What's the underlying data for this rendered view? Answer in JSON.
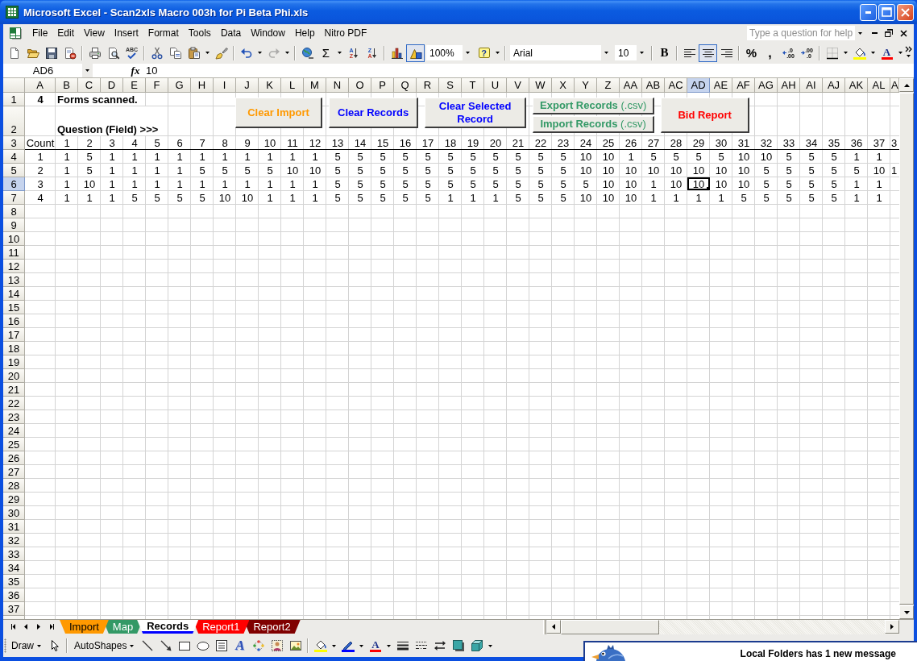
{
  "window": {
    "title": "Microsoft Excel - Scan2xls Macro 003h for Pi Beta Phi.xls"
  },
  "menu_bar": {
    "items": [
      "File",
      "Edit",
      "View",
      "Insert",
      "Format",
      "Tools",
      "Data",
      "Window",
      "Help",
      "Nitro PDF"
    ],
    "help_box": {
      "placeholder": "Type a question for help"
    }
  },
  "standard_toolbar": {
    "groups": [
      [
        {
          "kind": "new",
          "pressed": false,
          "disabled": false
        },
        {
          "kind": "open",
          "pressed": false,
          "disabled": false
        },
        {
          "kind": "save",
          "pressed": false,
          "disabled": false
        },
        {
          "kind": "permission",
          "pressed": false,
          "disabled": false
        }
      ],
      [
        {
          "kind": "print",
          "pressed": false,
          "disabled": false
        },
        {
          "kind": "print-preview",
          "pressed": false,
          "disabled": false
        },
        {
          "kind": "spelling",
          "label": "ABC",
          "pressed": false,
          "disabled": false
        }
      ],
      [
        {
          "kind": "cut",
          "pressed": false,
          "disabled": false
        },
        {
          "kind": "copy",
          "pressed": false,
          "disabled": false
        },
        {
          "kind": "paste",
          "pressed": false,
          "disabled": false
        },
        {
          "kind": "format-painter",
          "pressed": false,
          "disabled": false
        }
      ],
      [
        {
          "kind": "undo",
          "pressed": false,
          "disabled": false
        },
        {
          "kind": "redo",
          "pressed": false,
          "disabled": true
        }
      ],
      [
        {
          "kind": "hyperlink",
          "pressed": false,
          "disabled": false
        },
        {
          "kind": "autosum",
          "label": "Σ",
          "pressed": false,
          "disabled": false
        },
        {
          "kind": "sort-ascending",
          "glyphs": [
            "A",
            "Z"
          ],
          "pressed": false,
          "disabled": false
        },
        {
          "kind": "sort-descending",
          "glyphs": [
            "Z",
            "A"
          ],
          "pressed": false,
          "disabled": false
        }
      ],
      [
        {
          "kind": "chart-wizard",
          "pressed": false,
          "disabled": false
        },
        {
          "kind": "drawing",
          "pressed": true,
          "disabled": false
        },
        {
          "kind": "zoom",
          "value": "100%"
        },
        {
          "kind": "help",
          "label": "?",
          "pressed": false,
          "disabled": false
        }
      ],
      [
        {
          "kind": "font",
          "value": "Arial"
        },
        {
          "kind": "font-size",
          "value": "10"
        }
      ],
      [
        {
          "kind": "bold",
          "label": "B",
          "pressed": false,
          "disabled": false
        }
      ],
      [
        {
          "kind": "align-left",
          "pressed": false,
          "disabled": false
        },
        {
          "kind": "align-center",
          "pressed": true,
          "disabled": false
        },
        {
          "kind": "align-right",
          "pressed": false,
          "disabled": false
        }
      ],
      [
        {
          "kind": "percent",
          "label": "%",
          "pressed": false,
          "disabled": false
        },
        {
          "kind": "comma",
          "label": ",",
          "pressed": false,
          "disabled": false
        },
        {
          "kind": "increase-decimal",
          "glyphs": [
            ".0",
            ".00"
          ],
          "pressed": false,
          "disabled": false
        },
        {
          "kind": "decrease-decimal",
          "glyphs": [
            ".00",
            ".0"
          ],
          "pressed": false,
          "disabled": false
        }
      ],
      [
        {
          "kind": "borders",
          "pressed": false,
          "disabled": false
        },
        {
          "kind": "fill-color",
          "pressed": false,
          "disabled": false
        },
        {
          "kind": "font-color",
          "label": "A",
          "pressed": false,
          "disabled": false
        }
      ]
    ]
  },
  "formula_bar": {
    "name_box": "AD6",
    "function_label": "fx",
    "formula": "10"
  },
  "sheet": {
    "columns": [
      {
        "label": "A",
        "selected": false
      },
      {
        "label": "B",
        "selected": false
      },
      {
        "label": "C",
        "selected": false
      },
      {
        "label": "D",
        "selected": false
      },
      {
        "label": "E",
        "selected": false
      },
      {
        "label": "F",
        "selected": false
      },
      {
        "label": "G",
        "selected": false
      },
      {
        "label": "H",
        "selected": false
      },
      {
        "label": "I",
        "selected": false
      },
      {
        "label": "J",
        "selected": false
      },
      {
        "label": "K",
        "selected": false
      },
      {
        "label": "L",
        "selected": false
      },
      {
        "label": "M",
        "selected": false
      },
      {
        "label": "N",
        "selected": false
      },
      {
        "label": "O",
        "selected": false
      },
      {
        "label": "P",
        "selected": false
      },
      {
        "label": "Q",
        "selected": false
      },
      {
        "label": "R",
        "selected": false
      },
      {
        "label": "S",
        "selected": false
      },
      {
        "label": "T",
        "selected": false
      },
      {
        "label": "U",
        "selected": false
      },
      {
        "label": "V",
        "selected": false
      },
      {
        "label": "W",
        "selected": false
      },
      {
        "label": "X",
        "selected": false
      },
      {
        "label": "Y",
        "selected": false
      },
      {
        "label": "Z",
        "selected": false
      },
      {
        "label": "AA",
        "selected": false
      },
      {
        "label": "AB",
        "selected": false
      },
      {
        "label": "AC",
        "selected": false
      },
      {
        "label": "AD",
        "selected": true
      },
      {
        "label": "AE",
        "selected": false
      },
      {
        "label": "AF",
        "selected": false
      },
      {
        "label": "AG",
        "selected": false
      },
      {
        "label": "AH",
        "selected": false
      },
      {
        "label": "AI",
        "selected": false
      },
      {
        "label": "AJ",
        "selected": false
      },
      {
        "label": "AK",
        "selected": false
      },
      {
        "label": "AL",
        "selected": false
      },
      {
        "label": "A",
        "selected": false
      }
    ],
    "rows": [
      {
        "label": "1",
        "selected": false
      },
      {
        "label": "2",
        "selected": false
      },
      {
        "label": "3",
        "selected": false
      },
      {
        "label": "4",
        "selected": false
      },
      {
        "label": "5",
        "selected": false
      },
      {
        "label": "6",
        "selected": true
      },
      {
        "label": "7",
        "selected": false
      },
      {
        "label": "8",
        "selected": false
      },
      {
        "label": "9",
        "selected": false
      },
      {
        "label": "10",
        "selected": false
      },
      {
        "label": "11",
        "selected": false
      },
      {
        "label": "12",
        "selected": false
      },
      {
        "label": "13",
        "selected": false
      },
      {
        "label": "14",
        "selected": false
      },
      {
        "label": "15",
        "selected": false
      },
      {
        "label": "16",
        "selected": false
      },
      {
        "label": "17",
        "selected": false
      },
      {
        "label": "18",
        "selected": false
      },
      {
        "label": "19",
        "selected": false
      },
      {
        "label": "20",
        "selected": false
      },
      {
        "label": "21",
        "selected": false
      },
      {
        "label": "22",
        "selected": false
      },
      {
        "label": "23",
        "selected": false
      },
      {
        "label": "24",
        "selected": false
      },
      {
        "label": "25",
        "selected": false
      },
      {
        "label": "26",
        "selected": false
      },
      {
        "label": "27",
        "selected": false
      },
      {
        "label": "28",
        "selected": false
      },
      {
        "label": "29",
        "selected": false
      },
      {
        "label": "30",
        "selected": false
      },
      {
        "label": "31",
        "selected": false
      },
      {
        "label": "32",
        "selected": false
      },
      {
        "label": "33",
        "selected": false
      },
      {
        "label": "34",
        "selected": false
      },
      {
        "label": "35",
        "selected": false
      },
      {
        "label": "36",
        "selected": false
      },
      {
        "label": "37",
        "selected": false
      }
    ],
    "summary": {
      "count": "4",
      "caption": "Forms scanned.",
      "field_caption": "Question (Field) >>>"
    },
    "table": {
      "header": [
        "Count",
        "1",
        "2",
        "3",
        "4",
        "5",
        "6",
        "7",
        "8",
        "9",
        "10",
        "11",
        "12",
        "13",
        "14",
        "15",
        "16",
        "17",
        "18",
        "19",
        "20",
        "21",
        "22",
        "23",
        "24",
        "25",
        "26",
        "27",
        "28",
        "29",
        "30",
        "31",
        "32",
        "33",
        "34",
        "35",
        "36",
        "37",
        "3"
      ],
      "records": [
        [
          "1",
          "1",
          "5",
          "1",
          "1",
          "1",
          "1",
          "1",
          "1",
          "1",
          "1",
          "1",
          "1",
          "5",
          "5",
          "5",
          "5",
          "5",
          "5",
          "5",
          "5",
          "5",
          "5",
          "5",
          "10",
          "10",
          "1",
          "5",
          "5",
          "5",
          "5",
          "10",
          "10",
          "5",
          "5",
          "5",
          "1",
          "1"
        ],
        [
          "2",
          "1",
          "5",
          "1",
          "1",
          "1",
          "1",
          "5",
          "5",
          "5",
          "5",
          "10",
          "10",
          "5",
          "5",
          "5",
          "5",
          "5",
          "5",
          "5",
          "5",
          "5",
          "5",
          "5",
          "10",
          "10",
          "10",
          "10",
          "10",
          "10",
          "10",
          "10",
          "5",
          "5",
          "5",
          "5",
          "5",
          "10",
          "1"
        ],
        [
          "3",
          "1",
          "10",
          "1",
          "1",
          "1",
          "1",
          "1",
          "1",
          "1",
          "1",
          "1",
          "1",
          "5",
          "5",
          "5",
          "5",
          "5",
          "5",
          "5",
          "5",
          "5",
          "5",
          "5",
          "5",
          "10",
          "10",
          "1",
          "10",
          "10",
          "10",
          "10",
          "5",
          "5",
          "5",
          "5",
          "1",
          "1"
        ],
        [
          "4",
          "1",
          "1",
          "1",
          "5",
          "5",
          "5",
          "5",
          "10",
          "10",
          "1",
          "1",
          "1",
          "5",
          "5",
          "5",
          "5",
          "5",
          "1",
          "1",
          "1",
          "5",
          "5",
          "5",
          "10",
          "10",
          "10",
          "1",
          "1",
          "1",
          "1",
          "5",
          "5",
          "5",
          "5",
          "5",
          "1",
          "1"
        ]
      ]
    },
    "buttons": [
      {
        "kind": "macro",
        "label": "Clear Import",
        "color": "#ff9900"
      },
      {
        "kind": "macro",
        "label": "Clear Records",
        "color": "#0000ff"
      },
      {
        "kind": "macro",
        "label": "Clear Selected Record",
        "color": "#0000ff"
      },
      {
        "kind": "csv",
        "label": "**Export Records** (.csv)",
        "color": "#339966"
      },
      {
        "kind": "csv",
        "label": "**Import Records** (.csv)",
        "color": "#339966"
      },
      {
        "kind": "report",
        "label": "Bid Report",
        "color": "#ff0000"
      }
    ]
  },
  "sheet_tabs": [
    {
      "label": "Import",
      "color": "#ff9900",
      "selected": false
    },
    {
      "label": "Map",
      "color": "#339966",
      "selected": false
    },
    {
      "label": "Records",
      "color": "#0000ff",
      "selected": true
    },
    {
      "label": "Report1",
      "color": "#ff0000",
      "selected": false
    },
    {
      "label": "Report2",
      "color": "#800000",
      "selected": false
    }
  ],
  "drawing_toolbar": {
    "groups": [
      [
        {
          "kind": "menu",
          "label": "Draw"
        },
        {
          "kind": "select"
        }
      ],
      [
        {
          "kind": "menu",
          "label": "AutoShapes"
        },
        {
          "kind": "line"
        },
        {
          "kind": "arrow"
        },
        {
          "kind": "rectangle"
        },
        {
          "kind": "oval"
        },
        {
          "kind": "text-box"
        },
        {
          "kind": "wordart",
          "label": "A"
        },
        {
          "kind": "diagram"
        },
        {
          "kind": "clip-art"
        },
        {
          "kind": "picture"
        }
      ],
      [
        {
          "kind": "fill-color"
        },
        {
          "kind": "line-color"
        },
        {
          "kind": "font-color",
          "label": "A"
        },
        {
          "kind": "line-style"
        },
        {
          "kind": "dash-style"
        },
        {
          "kind": "arrow-style"
        },
        {
          "kind": "shadow"
        },
        {
          "kind": "depth"
        }
      ]
    ]
  },
  "notification": {
    "message": "Local Folders has 1 new message"
  }
}
